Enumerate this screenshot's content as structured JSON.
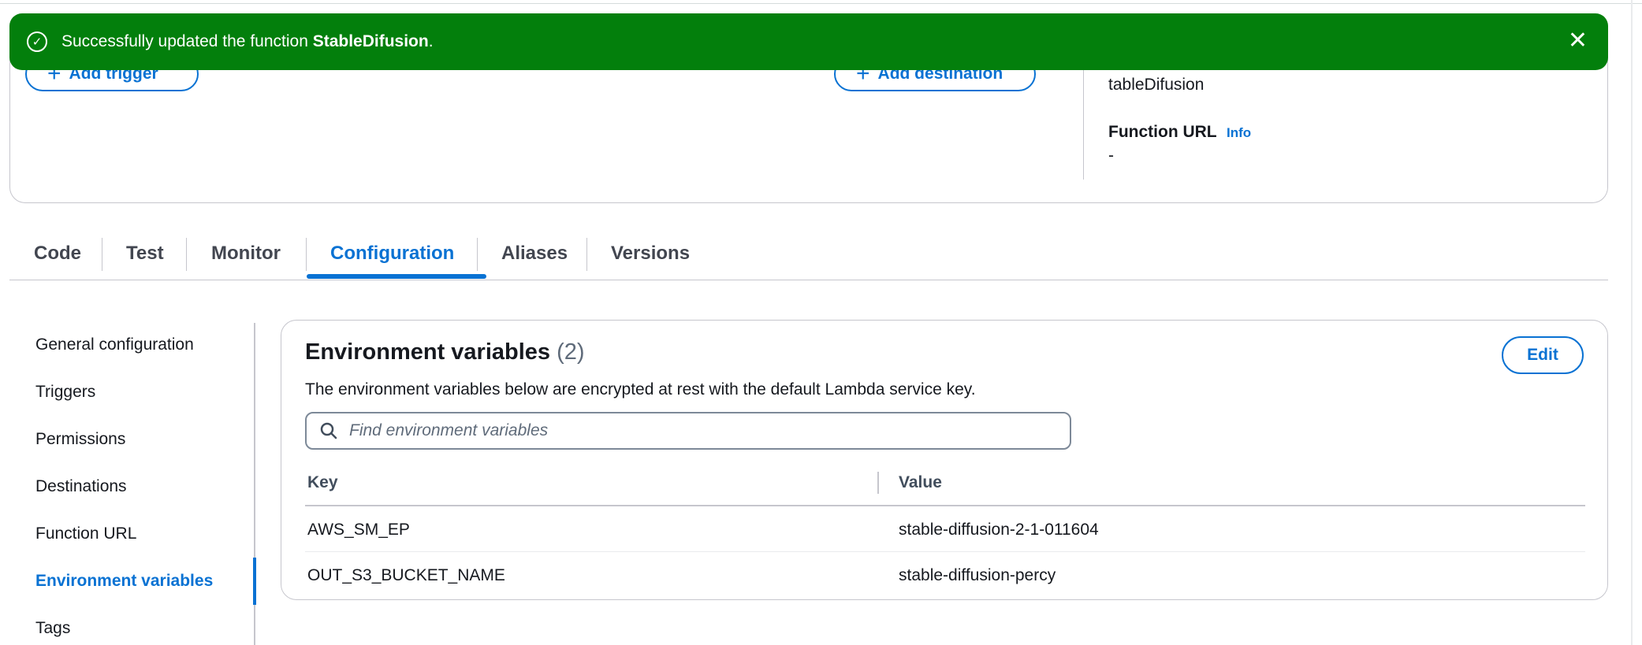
{
  "flash": {
    "message_prefix": "Successfully updated the function ",
    "function_name": "StableDifusion",
    "message_suffix": ".",
    "color": "#037f0c"
  },
  "overview": {
    "add_trigger_label": "Add trigger",
    "add_destination_label": "Add destination",
    "function_name_tail": "tableDifusion",
    "function_url_label": "Function URL",
    "function_url_info": "Info",
    "function_url_value": "-"
  },
  "tabs": [
    {
      "label": "Code"
    },
    {
      "label": "Test"
    },
    {
      "label": "Monitor"
    },
    {
      "label": "Configuration",
      "active": true
    },
    {
      "label": "Aliases"
    },
    {
      "label": "Versions"
    }
  ],
  "side_nav": [
    {
      "label": "General configuration"
    },
    {
      "label": "Triggers"
    },
    {
      "label": "Permissions"
    },
    {
      "label": "Destinations"
    },
    {
      "label": "Function URL"
    },
    {
      "label": "Environment variables",
      "active": true
    },
    {
      "label": "Tags"
    }
  ],
  "env": {
    "title": "Environment variables",
    "count": "(2)",
    "description": "The environment variables below are encrypted at rest with the default Lambda service key.",
    "edit_label": "Edit",
    "search_placeholder": "Find environment variables",
    "columns": {
      "key": "Key",
      "value": "Value"
    },
    "rows": [
      {
        "key": "AWS_SM_EP",
        "value": "stable-diffusion-2-1-011604"
      },
      {
        "key": "OUT_S3_BUCKET_NAME",
        "value": "stable-diffusion-percy"
      }
    ]
  },
  "colors": {
    "accent": "#0972d3",
    "success": "#037f0c"
  }
}
